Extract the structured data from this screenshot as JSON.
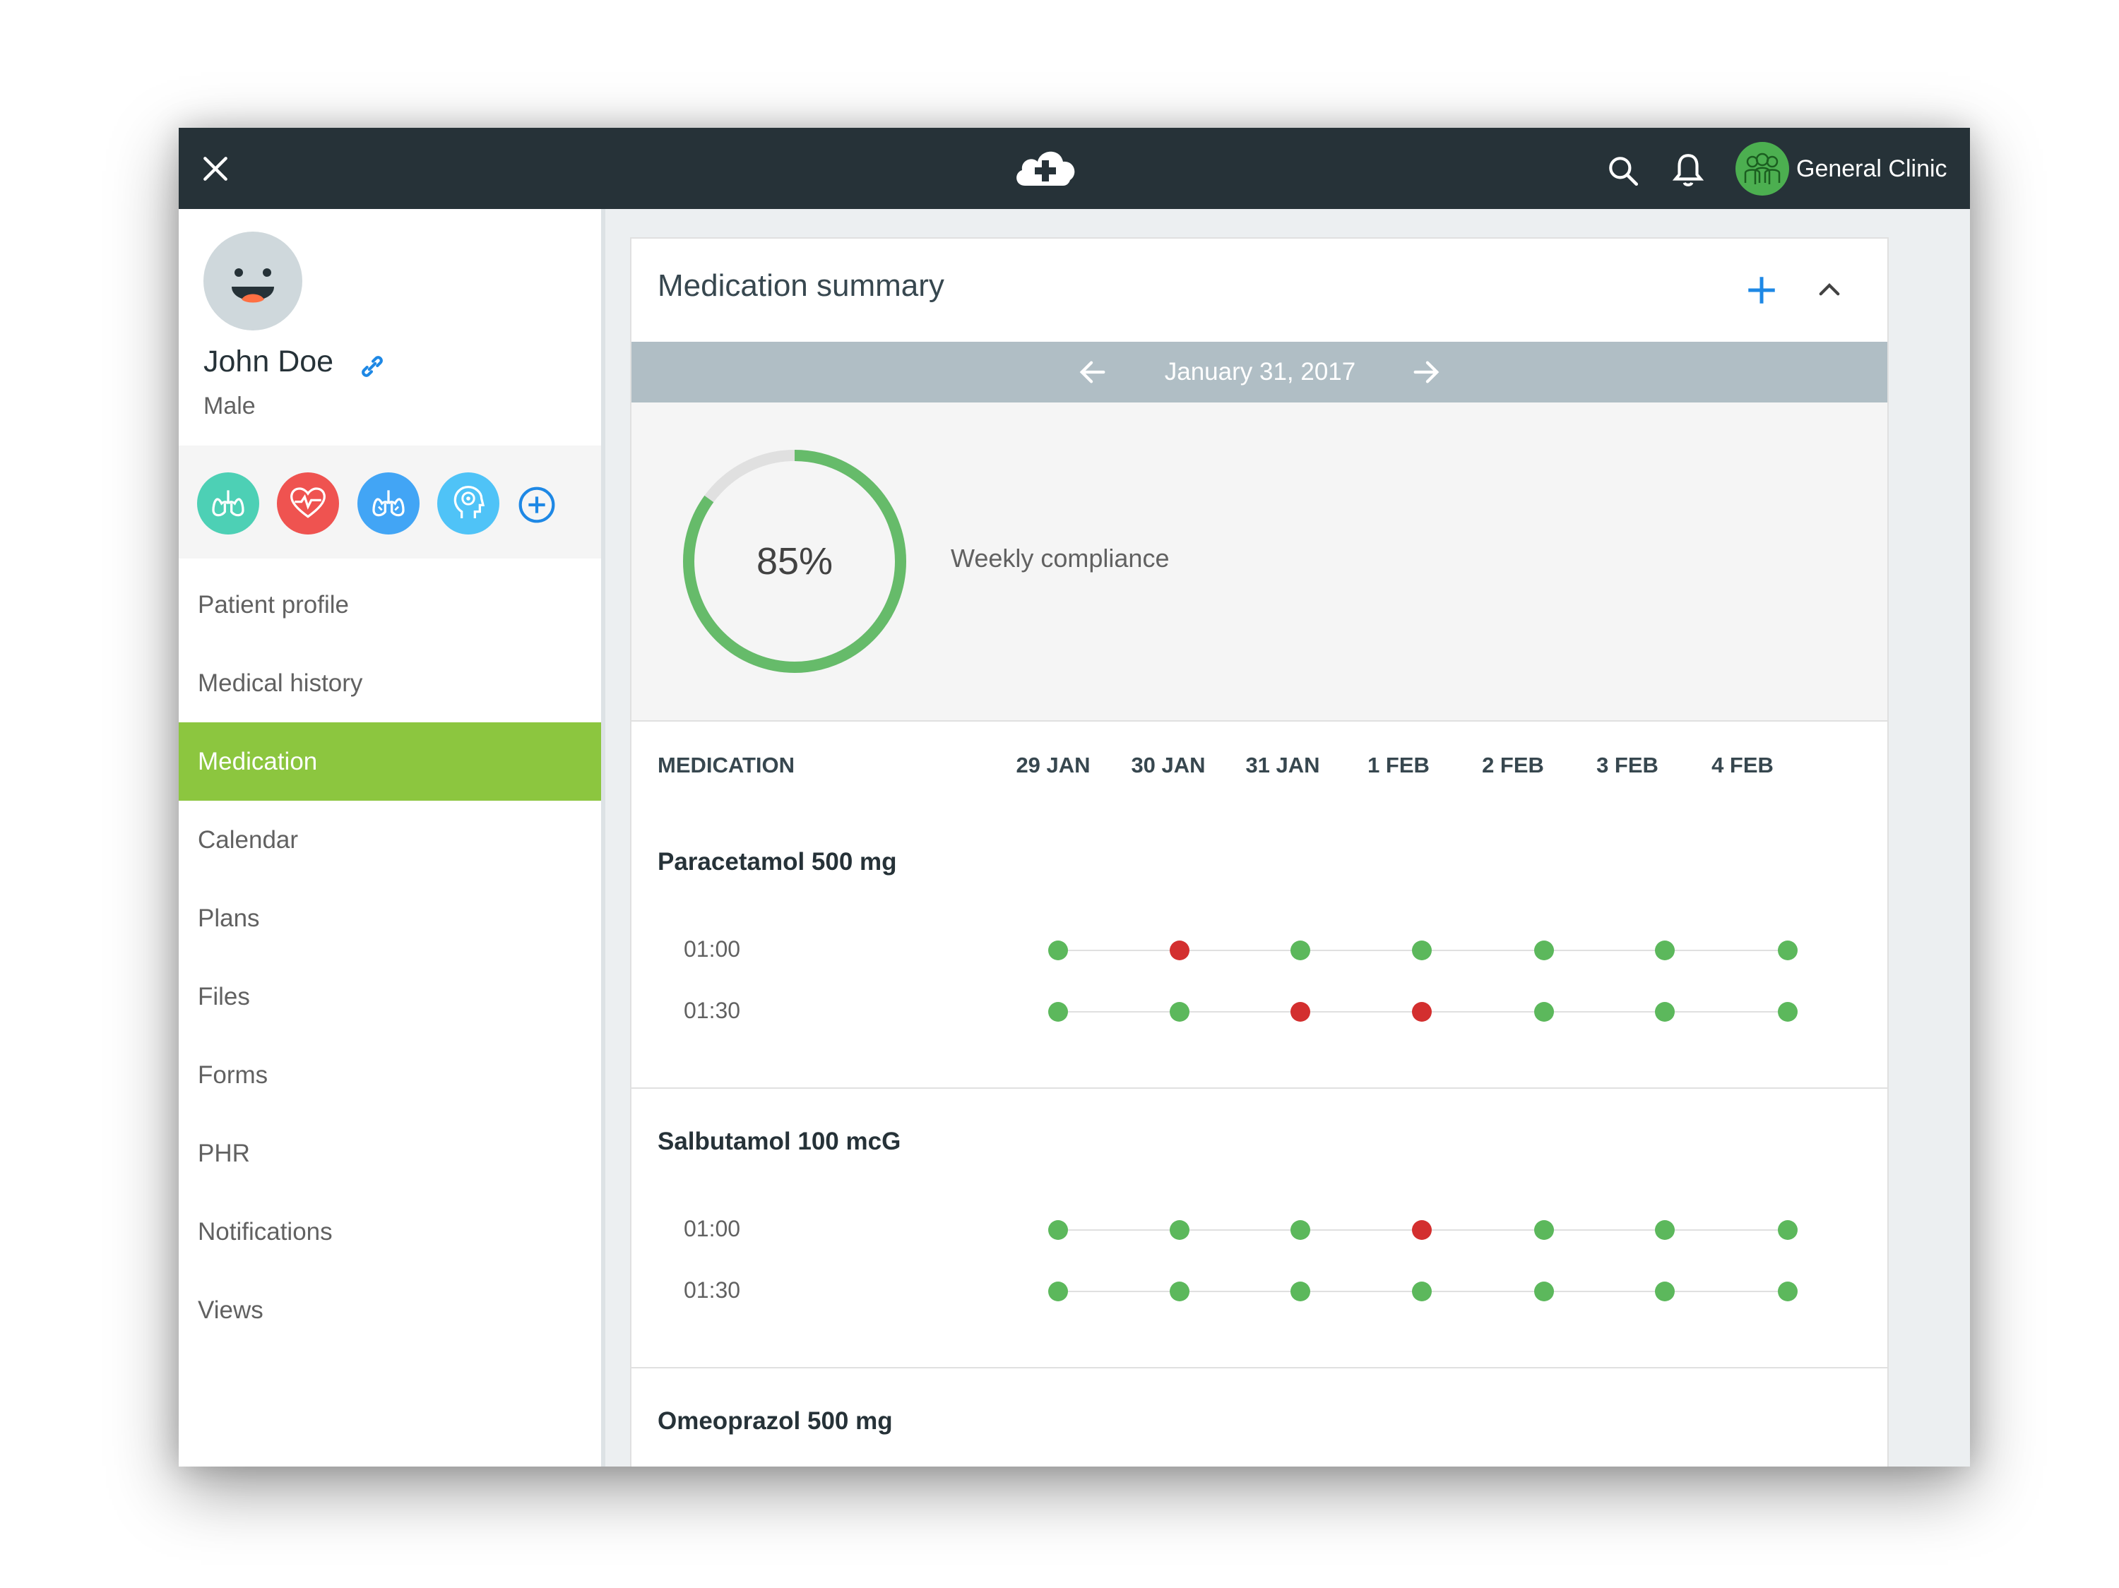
{
  "topbar": {
    "close_icon": "close-icon",
    "logo_icon": "cloud-medical-cross-icon",
    "search_icon": "search-icon",
    "bell_icon": "bell-icon",
    "clinic_name": "General Clinic",
    "clinic_icon": "group-people-icon"
  },
  "patient": {
    "name": "John Doe",
    "sex": "Male",
    "avatar_icon": "smiley-face-icon",
    "link_icon": "link-icon"
  },
  "conditions": [
    {
      "icon": "lungs-icon",
      "color": "#4dd0b5"
    },
    {
      "icon": "heart-pulse-icon",
      "color": "#ef5350"
    },
    {
      "icon": "lungs-icon",
      "color": "#42a5f5"
    },
    {
      "icon": "head-brain-icon",
      "color": "#4fc3f7"
    }
  ],
  "nav": {
    "items": [
      {
        "label": "Patient profile"
      },
      {
        "label": "Medical history"
      },
      {
        "label": "Medication"
      },
      {
        "label": "Calendar"
      },
      {
        "label": "Plans"
      },
      {
        "label": "Files"
      },
      {
        "label": "Forms"
      },
      {
        "label": "PHR"
      },
      {
        "label": "Notifications"
      },
      {
        "label": "Views"
      }
    ],
    "active": "Medication"
  },
  "summary": {
    "title": "Medication summary",
    "date": "January 31, 2017",
    "compliance_value": "85%",
    "compliance_fraction": 0.85,
    "compliance_label": "Weekly compliance"
  },
  "table": {
    "med_header": "MEDICATION",
    "days": [
      "29 JAN",
      "30 JAN",
      "31 JAN",
      "1 FEB",
      "2 FEB",
      "3 FEB",
      "4 FEB"
    ]
  },
  "medications": [
    {
      "name": "Paracetamol 500 mg",
      "doses": [
        {
          "time": "01:00",
          "status": [
            "taken",
            "missed",
            "taken",
            "taken",
            "taken",
            "taken",
            "taken"
          ]
        },
        {
          "time": "01:30",
          "status": [
            "taken",
            "taken",
            "missed",
            "missed",
            "taken",
            "taken",
            "taken"
          ]
        }
      ]
    },
    {
      "name": "Salbutamol 100 mcG",
      "doses": [
        {
          "time": "01:00",
          "status": [
            "taken",
            "taken",
            "taken",
            "missed",
            "taken",
            "taken",
            "taken"
          ]
        },
        {
          "time": "01:30",
          "status": [
            "taken",
            "taken",
            "taken",
            "taken",
            "taken",
            "taken",
            "taken"
          ]
        }
      ]
    },
    {
      "name": "Omeoprazol 500 mg",
      "doses": []
    }
  ],
  "colors": {
    "taken": "#5cb85c",
    "missed": "#d32f2f",
    "active_nav": "#8cc63f",
    "ring": "#66bb6a",
    "accent": "#1e88e5"
  }
}
